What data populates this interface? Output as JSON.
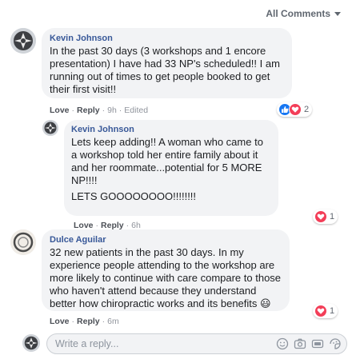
{
  "header": {
    "sort_label": "All Comments"
  },
  "comments": [
    {
      "author": "Kevin Johnson",
      "text": "In the past 30 days (3 workshops and 1 encore presentation) I have had 33 NP's scheduled!! I am running out of times to get people booked to get their first visit!!",
      "actions": {
        "love": "Love",
        "reply": "Reply",
        "time": "9h",
        "edited": "Edited"
      },
      "reactions": {
        "types": [
          "like",
          "love"
        ],
        "count": "2"
      },
      "replies": [
        {
          "author": "Kevin Johnson",
          "text": "Lets keep adding!! A woman who came to a workshop told her entire family about it and her roommate...potential for 5 MORE NP!!!!",
          "text2": "LETS GOOOOOOOO!!!!!!!!",
          "actions": {
            "love": "Love",
            "reply": "Reply",
            "time": "6h"
          },
          "reactions": {
            "types": [
              "love"
            ],
            "count": "1"
          }
        }
      ]
    },
    {
      "author": "Dulce Aguilar",
      "text": "32 new patients in the past 30 days. In my experience people attending to the workshop are more likely to continue with care compare to those who haven't attend because they understand better how chiropractic works and its benefits 😃",
      "actions": {
        "love": "Love",
        "reply": "Reply",
        "time": "6m"
      },
      "reactions": {
        "types": [
          "love"
        ],
        "count": "1"
      }
    }
  ],
  "reply_box": {
    "placeholder": "Write a reply..."
  },
  "colors": {
    "author": "#385898",
    "bubble": "#f2f3f5",
    "like": "#1877f2",
    "love": "#f33e58",
    "muted": "#90949c"
  },
  "icons": [
    "caret-down-icon",
    "like-icon",
    "love-icon",
    "emoji-icon",
    "camera-icon",
    "gif-icon",
    "sticker-icon"
  ]
}
